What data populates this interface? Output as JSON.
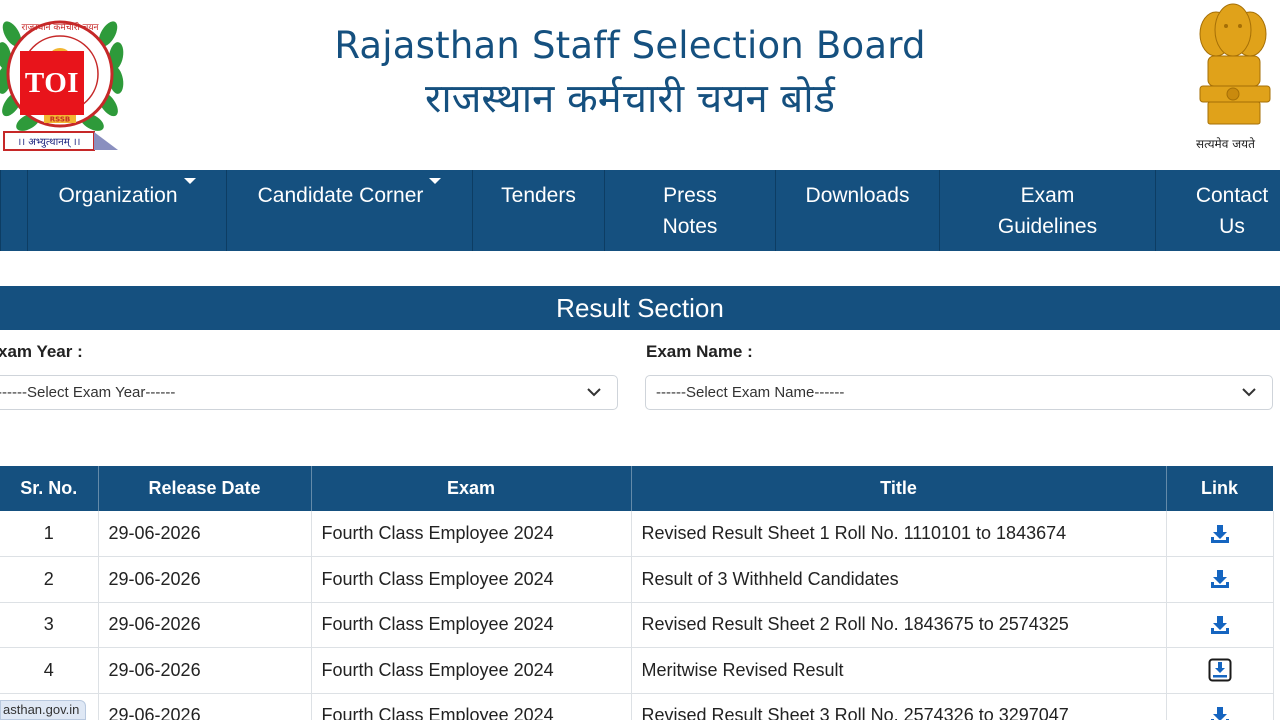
{
  "header": {
    "title_en": "Rajasthan Staff Selection Board",
    "title_hi": "राजस्थान कर्मचारी चयन बोर्ड",
    "logo_motto": "।। अभ्युत्थानम् ।।",
    "logo_ring_text": "राजस्थान कर्मचारी चयन",
    "logo_badge": "RSSB",
    "watermark": "TOI",
    "emblem_caption": "सत्यमेव जयते"
  },
  "nav": {
    "items": [
      {
        "label": "Organization",
        "dropdown": true
      },
      {
        "label": "Candidate Corner",
        "dropdown": true
      },
      {
        "label": "Tenders",
        "dropdown": false
      },
      {
        "label": "Press Notes",
        "dropdown": false
      },
      {
        "label": "Downloads",
        "dropdown": false
      },
      {
        "label": "Exam Guidelines",
        "dropdown": false
      },
      {
        "label": "Contact Us",
        "dropdown": false
      }
    ]
  },
  "section": {
    "title": "Result Section"
  },
  "filters": {
    "exam_year_label": "xam Year :",
    "exam_year_value": "------Select Exam Year------",
    "exam_name_label": "Exam Name :",
    "exam_name_value": "------Select Exam Name------"
  },
  "table": {
    "headers": [
      "Sr. No.",
      "Release Date",
      "Exam",
      "Title",
      "Link"
    ],
    "rows": [
      {
        "sr": "1",
        "date": "29-06-2026",
        "exam": "Fourth Class Employee 2024",
        "title": "Revised Result Sheet 1 Roll No. 1110101 to 1843674",
        "link_icon": "download-icon"
      },
      {
        "sr": "2",
        "date": "29-06-2026",
        "exam": "Fourth Class Employee 2024",
        "title": "Result of 3 Withheld Candidates",
        "link_icon": "download-icon"
      },
      {
        "sr": "3",
        "date": "29-06-2026",
        "exam": "Fourth Class Employee 2024",
        "title": "Revised Result Sheet 2 Roll No. 1843675 to 2574325",
        "link_icon": "download-icon"
      },
      {
        "sr": "4",
        "date": "29-06-2026",
        "exam": "Fourth Class Employee 2024",
        "title": "Meritwise Revised Result",
        "link_icon": "download-box-icon"
      },
      {
        "sr": "",
        "date": "29-06-2026",
        "exam": "Fourth Class Employee 2024",
        "title": "Revised Result Sheet 3 Roll No. 2574326 to 3297047",
        "link_icon": "download-icon"
      }
    ]
  },
  "status_bar": {
    "url": "asthan.gov.in"
  },
  "colors": {
    "brand_blue": "#15507f",
    "link_blue": "#1565c0",
    "toi_red": "#e8141b"
  }
}
